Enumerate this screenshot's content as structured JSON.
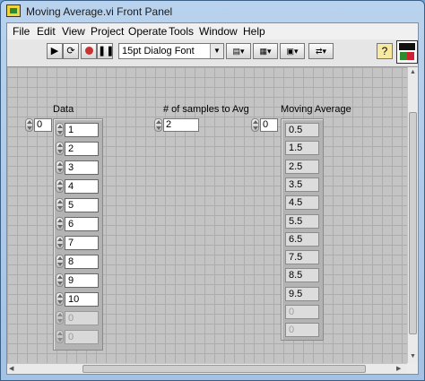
{
  "window": {
    "title": "Moving Average.vi Front Panel"
  },
  "menu": [
    "File",
    "Edit",
    "View",
    "Project",
    "Operate",
    "Tools",
    "Window",
    "Help"
  ],
  "toolbar": {
    "font_select": "15pt Dialog Font",
    "help": "?"
  },
  "controls": {
    "data": {
      "label": "Data",
      "index": "0",
      "values": [
        "1",
        "2",
        "3",
        "4",
        "5",
        "6",
        "7",
        "8",
        "9",
        "10",
        "0",
        "0"
      ],
      "active_count": 10
    },
    "samples": {
      "label": "# of samples to Avg",
      "value": "2"
    },
    "moving_average": {
      "label": "Moving Average",
      "index": "0",
      "values": [
        "0.5",
        "1.5",
        "2.5",
        "3.5",
        "4.5",
        "5.5",
        "6.5",
        "7.5",
        "8.5",
        "9.5",
        "0",
        "0"
      ],
      "active_count": 10
    }
  },
  "scroll": {
    "horizontal_position": 0.2,
    "vertical_position": 0.15
  }
}
